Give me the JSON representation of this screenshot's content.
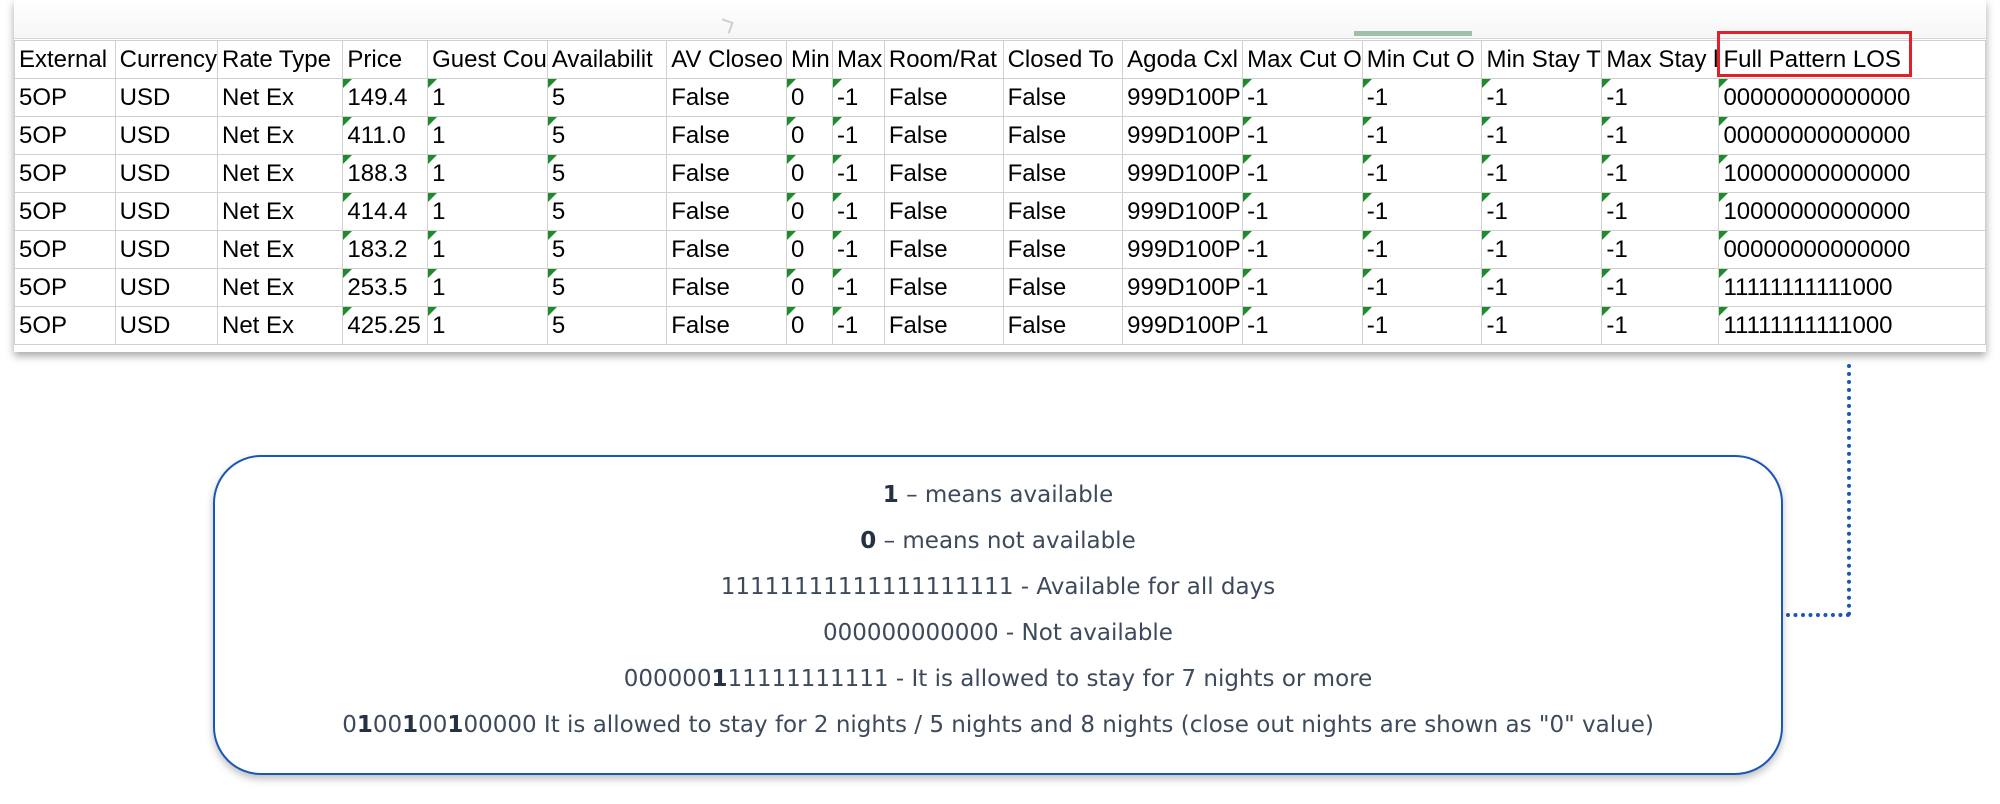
{
  "table": {
    "headers": [
      "External",
      "Currency",
      "Rate Type",
      "Price",
      "Guest Cou",
      "Availabilit",
      "AV Closeo",
      "Min",
      "Max",
      "Room/Rat",
      "Closed To",
      "Agoda Cxl",
      "Max Cut O",
      "Min Cut O",
      "Min Stay T",
      "Max Stay l",
      "Full Pattern LOS"
    ],
    "rows": [
      [
        "5OP",
        "USD",
        "Net Ex",
        "149.4",
        "1",
        "5",
        "False",
        "0",
        "-1",
        "False",
        "False",
        "999D100P",
        "-1",
        "-1",
        "-1",
        "-1",
        "00000000000000"
      ],
      [
        "5OP",
        "USD",
        "Net Ex",
        "411.0",
        "1",
        "5",
        "False",
        "0",
        "-1",
        "False",
        "False",
        "999D100P",
        "-1",
        "-1",
        "-1",
        "-1",
        "00000000000000"
      ],
      [
        "5OP",
        "USD",
        "Net Ex",
        "188.3",
        "1",
        "5",
        "False",
        "0",
        "-1",
        "False",
        "False",
        "999D100P",
        "-1",
        "-1",
        "-1",
        "-1",
        "10000000000000"
      ],
      [
        "5OP",
        "USD",
        "Net Ex",
        "414.4",
        "1",
        "5",
        "False",
        "0",
        "-1",
        "False",
        "False",
        "999D100P",
        "-1",
        "-1",
        "-1",
        "-1",
        "10000000000000"
      ],
      [
        "5OP",
        "USD",
        "Net Ex",
        "183.2",
        "1",
        "5",
        "False",
        "0",
        "-1",
        "False",
        "False",
        "999D100P",
        "-1",
        "-1",
        "-1",
        "-1",
        "00000000000000"
      ],
      [
        "5OP",
        "USD",
        "Net Ex",
        "253.5",
        "1",
        "5",
        "False",
        "0",
        "-1",
        "False",
        "False",
        "999D100P",
        "-1",
        "-1",
        "-1",
        "-1",
        "11111111111000"
      ],
      [
        "5OP",
        "USD",
        "Net Ex",
        "425.25",
        "1",
        "5",
        "False",
        "0",
        "-1",
        "False",
        "False",
        "999D100P",
        "-1",
        "-1",
        "-1",
        "-1",
        "11111111111000"
      ]
    ],
    "number_stored_as_text_columns": [
      3,
      4,
      5,
      7,
      8,
      12,
      13,
      14,
      15,
      16
    ],
    "highlighted_column": "Full Pattern LOS"
  },
  "legend": {
    "line1": {
      "key": "1",
      "text": " –  means available"
    },
    "line2": {
      "key": "0",
      "text": " –  means  not available"
    },
    "line3": "11111111111111111111 - Available for all days",
    "line4": "000000000000 - Not available",
    "line5": {
      "prefix": "000000",
      "bold": "1",
      "rest": "11111111111 - It is allowed to stay for 7 nights or more"
    },
    "line6": {
      "parts": [
        {
          "t": "0",
          "b": false
        },
        {
          "t": "1",
          "b": true
        },
        {
          "t": "00",
          "b": false
        },
        {
          "t": "1",
          "b": true
        },
        {
          "t": "00",
          "b": false
        },
        {
          "t": "1",
          "b": true
        },
        {
          "t": "00000 It is allowed to stay for 2 nights / 5 nights and 8 nights (close out nights are shown as \"0\" value)",
          "b": false
        }
      ]
    }
  },
  "colors": {
    "highlight_border": "#e0202a",
    "callout_border": "#1a56b8",
    "error_triangle": "#1e8b2c",
    "legend_text": "#3d4a5c"
  }
}
